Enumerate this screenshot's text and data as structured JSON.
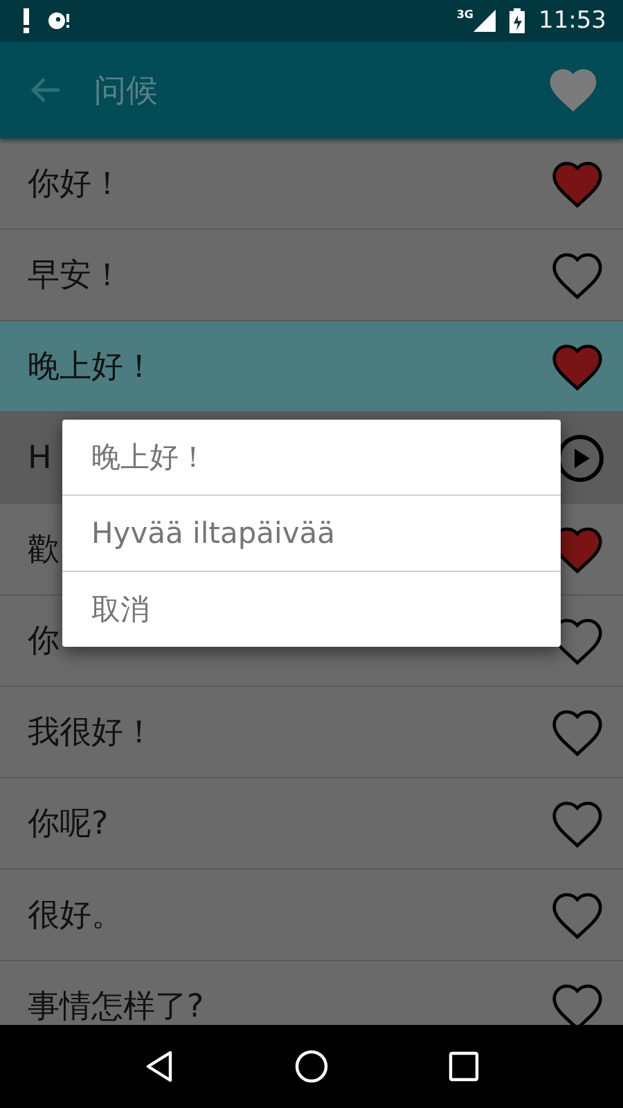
{
  "status_bar": {
    "network": "3G",
    "time": "11:53"
  },
  "toolbar": {
    "title": "问候"
  },
  "rows": [
    {
      "text": "你好！",
      "kind": "phrase",
      "favorite": true,
      "selected": false
    },
    {
      "text": "早安！",
      "kind": "phrase",
      "favorite": false,
      "selected": false
    },
    {
      "text": "晚上好！",
      "kind": "phrase",
      "favorite": true,
      "selected": true
    },
    {
      "text": "H",
      "kind": "translation",
      "selected": false
    },
    {
      "text": "歡",
      "kind": "phrase",
      "favorite": true,
      "selected": false
    },
    {
      "text": "你",
      "kind": "phrase",
      "favorite": false,
      "selected": false
    },
    {
      "text": "我很好！",
      "kind": "phrase",
      "favorite": false,
      "selected": false
    },
    {
      "text": "你呢?",
      "kind": "phrase",
      "favorite": false,
      "selected": false
    },
    {
      "text": "很好。",
      "kind": "phrase",
      "favorite": false,
      "selected": false
    },
    {
      "text": "事情怎样了?",
      "kind": "phrase",
      "favorite": false,
      "selected": false
    }
  ],
  "dialog": {
    "options": [
      "晚上好！",
      "Hyvää iltapäivää",
      "取消"
    ]
  }
}
